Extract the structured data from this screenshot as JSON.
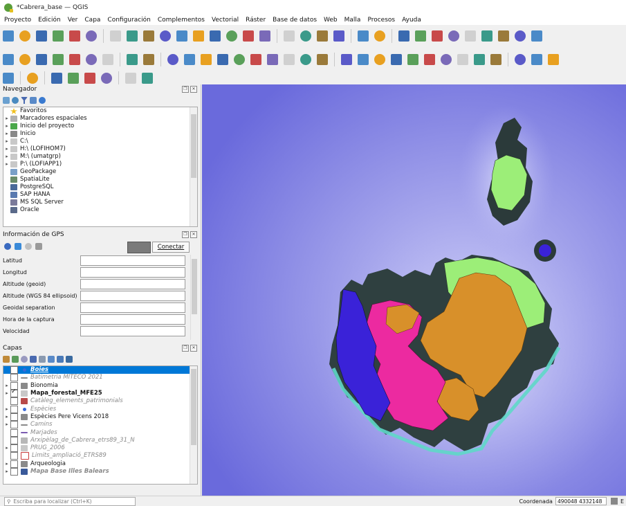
{
  "window": {
    "title": "*Cabrera_base — QGIS"
  },
  "menu": [
    "Proyecto",
    "Edición",
    "Ver",
    "Capa",
    "Configuración",
    "Complementos",
    "Vectorial",
    "Ráster",
    "Base de datos",
    "Web",
    "Malla",
    "Procesos",
    "Ayuda"
  ],
  "toolbar_icons": {
    "row1": [
      "new-project-icon",
      "open-project-icon",
      "save-project-icon",
      "save-as-icon",
      "print-layout-icon",
      "style-manager-icon",
      "pan-icon",
      "pan-to-selection-icon",
      "zoom-in-icon",
      "zoom-out-icon",
      "zoom-full-icon",
      "zoom-selection-icon",
      "zoom-layer-icon",
      "zoom-native-icon",
      "zoom-last-icon",
      "zoom-next-icon",
      "new-bookmark-icon",
      "show-bookmarks-icon",
      "temporal-controller-icon",
      "refresh-icon",
      "identify-icon",
      "select-icon",
      "open-table-icon",
      "measure-icon",
      "statistics-icon",
      "spatial-bookmark-icon",
      "annotation-icon",
      "map-tips-icon",
      "sum-icon",
      "field-calc-icon",
      "toolbox-icon"
    ],
    "row2": [
      "add-vector-icon",
      "add-raster-icon",
      "add-delimited-icon",
      "add-spatialite-icon",
      "add-postgis-icon",
      "add-wms-icon",
      "new-shapefile-icon",
      "digitize-icon",
      "pencil-icon",
      "save-edits-icon",
      "add-feature-icon",
      "vertex-tool-icon",
      "add-ring-icon",
      "delete-selected-icon",
      "cut-icon",
      "copy-icon",
      "paste-icon",
      "undo-icon",
      "redo-icon",
      "label-icon",
      "label-pin-icon",
      "label-show-icon",
      "label-move-icon",
      "label-rotate-icon",
      "label-change-icon",
      "label-a-icon",
      "label-b-icon",
      "label-c-icon",
      "label-d-icon",
      "plugin-icon",
      "python-icon",
      "help-icon"
    ],
    "row3": [
      "gps-pan-icon",
      "gps-add-icon",
      "digitize-gps-icon",
      "gps-track-icon",
      "gps-points-icon",
      "gps-clear-icon",
      "info-icon",
      "gps-settings-icon"
    ]
  },
  "navigator": {
    "title": "Navegador",
    "items": [
      {
        "label": "Favoritos",
        "icon": "star-icon",
        "color": "#f0c020"
      },
      {
        "label": "Marcadores espaciales",
        "icon": "bookmarks-icon",
        "color": "#b0b0b0"
      },
      {
        "label": "Inicio del proyecto",
        "icon": "project-home-icon",
        "color": "#4aa84a"
      },
      {
        "label": "Inicio",
        "icon": "home-icon",
        "color": "#888888"
      },
      {
        "label": "C:\\",
        "icon": "drive-icon",
        "color": "#c8c8c8"
      },
      {
        "label": "H:\\ (LOFIHOM7)",
        "icon": "drive-icon",
        "color": "#c8c8c8"
      },
      {
        "label": "M:\\ (umatgrp)",
        "icon": "drive-icon",
        "color": "#c8c8c8"
      },
      {
        "label": "P:\\ (LOFIAPP1)",
        "icon": "drive-icon",
        "color": "#c8c8c8"
      },
      {
        "label": "GeoPackage",
        "icon": "geopackage-icon",
        "color": "#7aa0c8"
      },
      {
        "label": "SpatiaLite",
        "icon": "spatialite-icon",
        "color": "#6a8c6a"
      },
      {
        "label": "PostgreSQL",
        "icon": "postgresql-icon",
        "color": "#4a6a9a"
      },
      {
        "label": "SAP HANA",
        "icon": "sap-hana-icon",
        "color": "#5a7ab0"
      },
      {
        "label": "MS SQL Server",
        "icon": "mssql-icon",
        "color": "#7a7a9a"
      },
      {
        "label": "Oracle",
        "icon": "oracle-icon",
        "color": "#5a6a8a"
      }
    ]
  },
  "gps": {
    "title": "Información de GPS",
    "connect": "Conectar",
    "fields": [
      "Latitud",
      "Longitud",
      "Altitude (geoid)",
      "Altitude (WGS 84 ellipsoid)",
      "Geoidal separation",
      "Hora de la captura",
      "Velocidad"
    ]
  },
  "layers": {
    "title": "Capas",
    "items": [
      {
        "label": "Boies",
        "style": "selected",
        "icon": "point-icon",
        "checked": false,
        "arrow": false
      },
      {
        "label": "Batimetria MITECO 2021",
        "style": "gray",
        "icon": "line-icon",
        "checked": false,
        "arrow": false
      },
      {
        "label": "Bionomia",
        "style": "normal",
        "icon": "group-icon",
        "checked": false,
        "arrow": true
      },
      {
        "label": "Mapa_forestal_MFE25",
        "style": "bold",
        "icon": "polygon-icon",
        "checked": true,
        "arrow": true
      },
      {
        "label": "Catàleg_elements_patrimonials",
        "style": "gray",
        "icon": "polygon-red-icon",
        "checked": false,
        "arrow": false
      },
      {
        "label": "Espècies",
        "style": "gray",
        "icon": "point-icon",
        "checked": false,
        "arrow": true
      },
      {
        "label": "Espècies Pere Vicens 2018",
        "style": "normal",
        "icon": "group-icon",
        "checked": false,
        "arrow": true
      },
      {
        "label": "Camins",
        "style": "gray",
        "icon": "line-icon",
        "checked": false,
        "arrow": true
      },
      {
        "label": "Marjades",
        "style": "gray",
        "icon": "line-purple-icon",
        "checked": false,
        "arrow": false
      },
      {
        "label": "Arxipèlag_de_Cabrera_etrs89_31_N",
        "style": "gray",
        "icon": "polygon-gray-icon",
        "checked": false,
        "arrow": false
      },
      {
        "label": "PRUG_2006",
        "style": "gray",
        "icon": "polygon-icon",
        "checked": false,
        "arrow": true
      },
      {
        "label": "Limits_ampliació_ETRS89",
        "style": "gray",
        "icon": "polygon-outline-icon",
        "checked": false,
        "arrow": false
      },
      {
        "label": "Arqueologia",
        "style": "normal",
        "icon": "group-icon",
        "checked": false,
        "arrow": true
      },
      {
        "label": "Mapa Base Illes Balears",
        "style": "bold-gray",
        "icon": "wms-icon",
        "checked": false,
        "arrow": true
      }
    ]
  },
  "status": {
    "locator_placeholder": "Escriba para localizar (Ctrl+K)",
    "coord_label": "Coordenada",
    "coord_value": "490048 4332148",
    "extra": "E"
  },
  "map_colors": {
    "sea_dark": "#6a6adc",
    "sea_light": "#b8b8f0",
    "shallow": "#5fd8c8",
    "forest_green": "#9cee78",
    "forest_orange": "#d8902a",
    "forest_pink": "#ec2aa0",
    "forest_blue": "#3a22d8"
  }
}
